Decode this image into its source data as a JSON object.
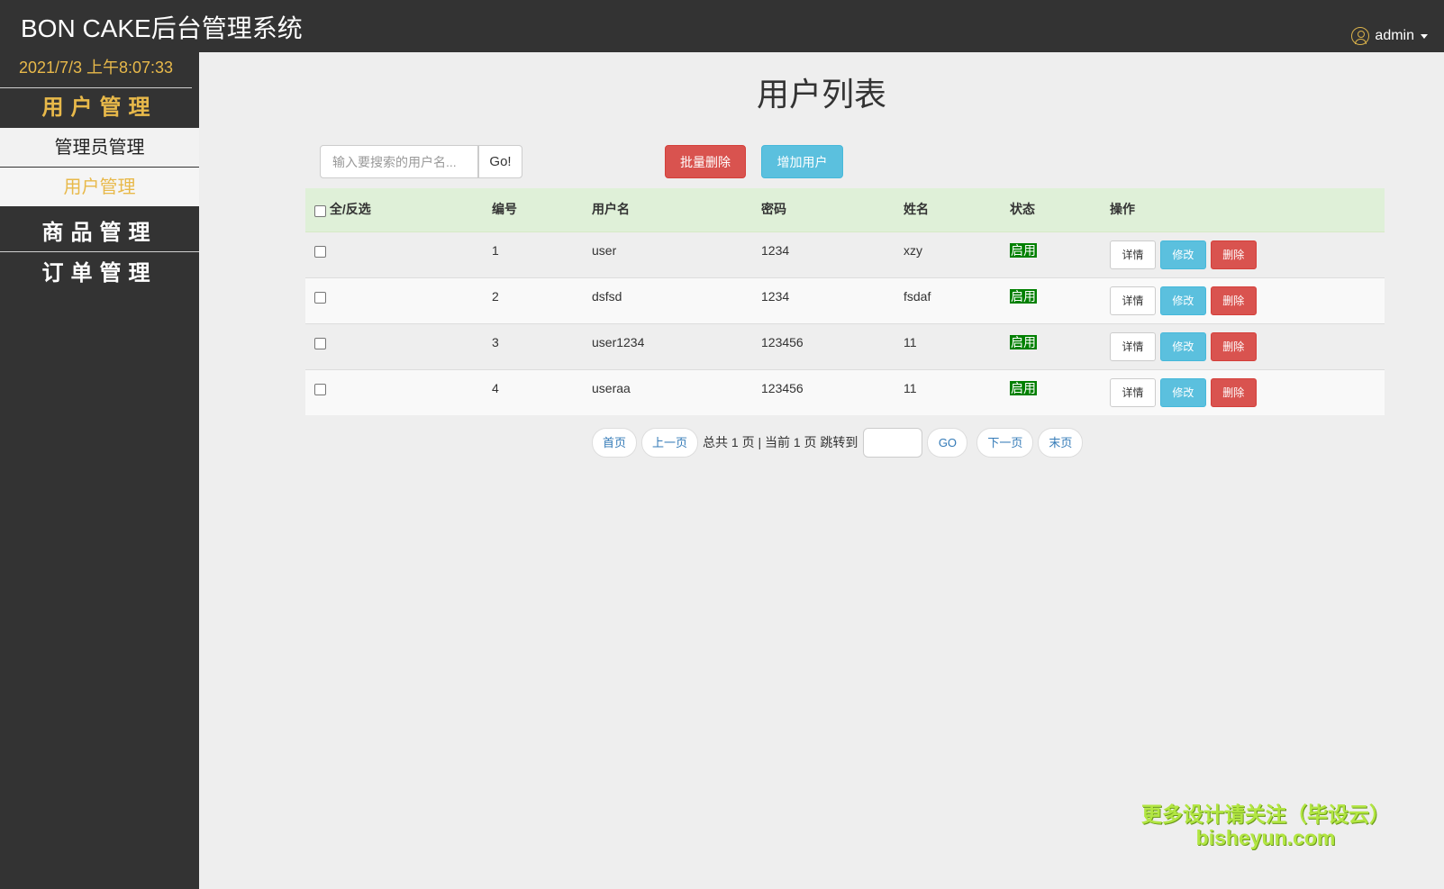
{
  "header": {
    "brand": "BON CAKE后台管理系统",
    "user": "admin"
  },
  "sidebar": {
    "clock": "2021/7/3 上午8:07:33",
    "user_group": "用户管理",
    "admin_manage": "管理员管理",
    "user_manage": "用户管理",
    "goods_manage": "商品管理",
    "order_manage": "订单管理"
  },
  "main": {
    "title": "用户列表",
    "search_placeholder": "输入要搜索的用户名...",
    "go_label": "Go!",
    "batch_delete_label": "批量删除",
    "add_user_label": "增加用户"
  },
  "table": {
    "headers": {
      "select_all": "全/反选",
      "id": "编号",
      "username": "用户名",
      "password": "密码",
      "name": "姓名",
      "status": "状态",
      "actions": "操作"
    },
    "rows": [
      {
        "id": "1",
        "username": "user",
        "password": "1234",
        "name": "xzy",
        "status": "启用"
      },
      {
        "id": "2",
        "username": "dsfsd",
        "password": "1234",
        "name": "fsdaf",
        "status": "启用"
      },
      {
        "id": "3",
        "username": "user1234",
        "password": "123456",
        "name": "11",
        "status": "启用"
      },
      {
        "id": "4",
        "username": "useraa",
        "password": "123456",
        "name": "11",
        "status": "启用"
      }
    ],
    "detail_label": "详情",
    "edit_label": "修改",
    "delete_label": "删除"
  },
  "pager": {
    "first": "首页",
    "prev": "上一页",
    "info": "总共 1 页 | 当前 1 页 跳转到",
    "go": "GO",
    "next": "下一页",
    "last": "末页"
  },
  "watermark": {
    "line1": "更多设计请关注（毕设云）",
    "line2": "bisheyun.com"
  },
  "colors": {
    "dark_bg": "#333333",
    "accent_gold": "#e8b94a",
    "danger": "#d9534f",
    "info": "#5bc0de",
    "header_green": "#dff0d8",
    "status_green": "#008000"
  }
}
